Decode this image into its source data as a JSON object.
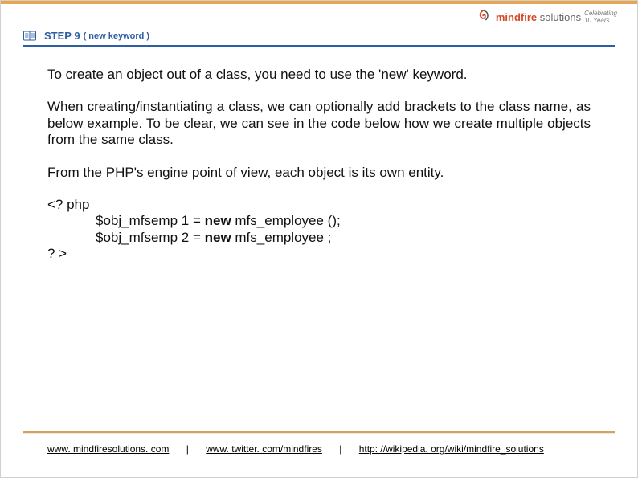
{
  "header": {
    "step_label": "STEP 9",
    "step_paren": "( new keyword  )"
  },
  "logo": {
    "brand_a": "mindfire",
    "brand_b": " solutions",
    "celebrating_line1": "Celebrating",
    "celebrating_line2": "10 Years"
  },
  "body": {
    "p1_a": "To create an ",
    "p1_b": "object",
    "p1_c": " out of a class, you need to use the '",
    "p1_d": "new",
    "p1_e": "' keyword.",
    "p2_a": "When creating/instantiating a class, we can ",
    "p2_b": "optionally",
    "p2_c": " add brackets to the class name, as below example. To be clear, we can see in the code below how we create multiple objects from the same class.",
    "p3_a": "From the PHP's engine point of view, each ",
    "p3_b": "object",
    "p3_c": " is its own ",
    "p3_d": "entity",
    "p3_e": "."
  },
  "code": {
    "open": "<? php",
    "line1_a": "$obj_mfsemp 1 = ",
    "line1_b": "new",
    "line1_c": " mfs_employee ();",
    "line2_a": "$obj_mfsemp 2 = ",
    "line2_b": "new",
    "line2_c": " mfs_employee ;",
    "close": "? >"
  },
  "footer": {
    "link1": "www. mindfiresolutions. com",
    "link2": "www. twitter. com/mindfires",
    "link3": "http: //wikipedia. org/wiki/mindfire_solutions",
    "sep": "|"
  }
}
